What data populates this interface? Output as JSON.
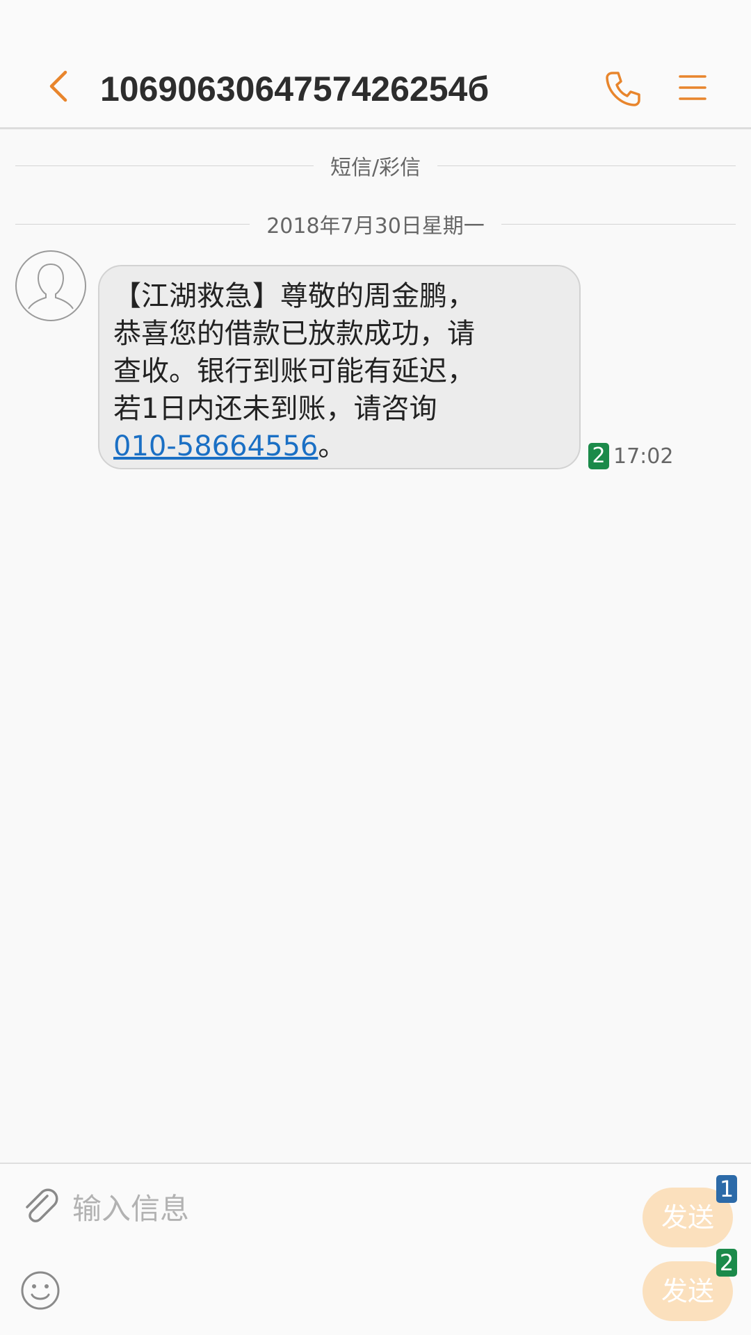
{
  "header": {
    "contact_number": "1069063064757426254б"
  },
  "conversation": {
    "type_label": "短信/彩信",
    "date_label": "2018年7月30日星期一",
    "messages": [
      {
        "lines": [
          "【江湖救急】尊敬的周金鹏，",
          "恭喜您的借款已放款成功，请",
          "查收。银行到账可能有延迟，",
          "若1日内还未到账，请咨询"
        ],
        "phone": "010-58664556",
        "suffix": "。",
        "sim": "2",
        "time": "17:02"
      }
    ]
  },
  "input": {
    "placeholder": "输入信息",
    "send_sim1": {
      "label": "发送",
      "sim": "1"
    },
    "send_sim2": {
      "label": "发送",
      "sim": "2"
    }
  },
  "colors": {
    "accent": "#e8852c",
    "sim1": "#2c6aa8",
    "sim2": "#1b8a4a",
    "link": "#1a6fc4",
    "send_bg": "#fbe0bd"
  },
  "icons": {
    "back": "chevron-left-icon",
    "call": "phone-icon",
    "menu": "menu-icon",
    "attach": "paperclip-icon",
    "emoji": "smiley-icon",
    "avatar": "person-silhouette-icon"
  }
}
